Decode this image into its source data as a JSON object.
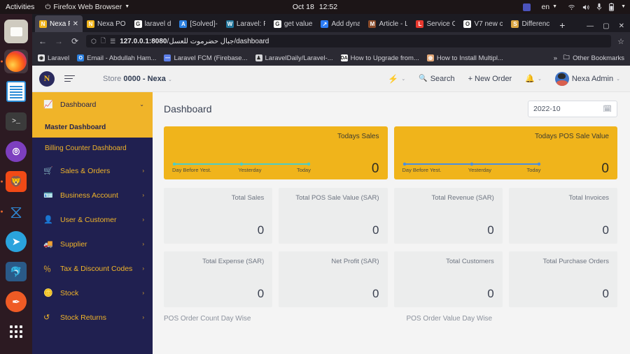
{
  "os_bar": {
    "activities": "Activities",
    "app_name": "Firefox Web Browser",
    "date": "Oct 18",
    "time": "12:52",
    "keyboard": "en",
    "tray_icons": [
      "teams-icon",
      "wifi-icon",
      "volume-icon",
      "microphone-icon",
      "battery-icon"
    ]
  },
  "dock": {
    "items": [
      {
        "name": "files-app",
        "label": "Files"
      },
      {
        "name": "firefox-app",
        "label": "Firefox Web Browser"
      },
      {
        "name": "libreoffice-writer-app",
        "label": "LibreOffice Writer"
      },
      {
        "name": "terminal-app",
        "label": "Terminal"
      },
      {
        "name": "github-desktop-app",
        "label": "GitHub Desktop"
      },
      {
        "name": "brave-browser-app",
        "label": "Brave Browser"
      },
      {
        "name": "vscode-app",
        "label": "Visual Studio Code"
      },
      {
        "name": "telegram-app",
        "label": "Telegram"
      },
      {
        "name": "mysql-workbench-app",
        "label": "MySQL Workbench"
      },
      {
        "name": "postman-app",
        "label": "Postman"
      },
      {
        "name": "show-applications",
        "label": "Show Applications"
      }
    ]
  },
  "browser": {
    "tabs": [
      {
        "title": "Nexa P",
        "favicon_letter": "N",
        "favicon_color": "#f0b41b",
        "selected": true
      },
      {
        "title": "Nexa PO",
        "favicon_letter": "N",
        "favicon_color": "#f0b41b",
        "selected": false
      },
      {
        "title": "laravel d",
        "favicon_letter": "G",
        "favicon_color": "#ffffff",
        "selected": false
      },
      {
        "title": "[Solved]-",
        "favicon_letter": "A",
        "favicon_color": "#2a7fe0",
        "selected": false
      },
      {
        "title": "Laravel: F",
        "favicon_letter": "W",
        "favicon_color": "#21759b",
        "selected": false
      },
      {
        "title": "get value",
        "favicon_letter": "G",
        "favicon_color": "#ffffff",
        "selected": false
      },
      {
        "title": "Add dyna",
        "favicon_letter": "↗",
        "favicon_color": "#2d7df6",
        "selected": false
      },
      {
        "title": "Article - L",
        "favicon_letter": "M",
        "favicon_color": "#8a4b2a",
        "selected": false
      },
      {
        "title": "Service C",
        "favicon_letter": "L",
        "favicon_color": "#e8392f",
        "selected": false
      },
      {
        "title": "V7 new c",
        "favicon_letter": "O",
        "favicon_color": "#ffffff",
        "selected": false
      },
      {
        "title": "Differenc",
        "favicon_letter": "S",
        "favicon_color": "#d9a441",
        "selected": false
      }
    ],
    "new_tab_label": "+",
    "window_controls": [
      "minimize",
      "maximize",
      "close"
    ],
    "nav": {
      "back": "←",
      "forward": "→",
      "reload": "⟳",
      "url_prefix": "127.0.0.1:8080",
      "url_suffix": "/جبال حضرموت للعسل/dashboard",
      "shield_icon": "shield-icon",
      "page_icon": "page-icon",
      "reader_icon": "reader-icon",
      "bookmark_star": "☆"
    },
    "bookmarks": [
      {
        "label": "Laravel",
        "letter": "◉",
        "color": "#e8e8ea"
      },
      {
        "label": "Email - Abdullah Ham...",
        "letter": "O",
        "color": "#2a7fe0"
      },
      {
        "label": "Laravel FCM (Firebase...",
        "letter": "—",
        "color": "#5c7ee8"
      },
      {
        "label": "LaravelDaily/Laravel-...",
        "letter": "♟",
        "color": "#d7d7da"
      },
      {
        "label": "How to Upgrade from...",
        "letter": "DA",
        "color": "#ffffff"
      },
      {
        "label": "How to Install Multipl...",
        "letter": "◍",
        "color": "#e2a878"
      }
    ],
    "bookmarks_overflow": "»",
    "other_bookmarks": "Other Bookmarks"
  },
  "app": {
    "header": {
      "logo_letter": "N",
      "store_prefix": "Store",
      "store_name": "0000 - Nexa",
      "quick_action_icon": "bolt-icon",
      "search_label": "Search",
      "new_order_label": "+ New Order",
      "notification_icon": "bell-icon",
      "user_name": "Nexa Admin"
    },
    "sidebar": {
      "items": [
        {
          "label": "Dashboard",
          "icon": "chart-line-icon",
          "chevron": "⌄",
          "active": true
        },
        {
          "label": "Master Dashboard",
          "type": "sub",
          "active": true
        },
        {
          "label": "Billing Counter Dashboard",
          "type": "sub",
          "active": false
        },
        {
          "label": "Sales & Orders",
          "icon": "cart-icon",
          "chevron": "›",
          "active": false
        },
        {
          "label": "Business Account",
          "icon": "card-icon",
          "chevron": "›",
          "active": false
        },
        {
          "label": "User & Customer",
          "icon": "user-icon",
          "chevron": "›",
          "active": false
        },
        {
          "label": "Supplier",
          "icon": "truck-icon",
          "chevron": "›",
          "active": false
        },
        {
          "label": "Tax & Discount Codes",
          "icon": "percent-icon",
          "chevron": "›",
          "active": false
        },
        {
          "label": "Stock",
          "icon": "coins-icon",
          "chevron": "›",
          "active": false
        },
        {
          "label": "Stock Returns",
          "icon": "undo-icon",
          "chevron": "›",
          "active": false
        }
      ]
    },
    "main": {
      "page_title": "Dashboard",
      "date_value": "2022-10",
      "calendar_icon": "calendar-icon",
      "highlight_cards": [
        {
          "title": "Todays Sales",
          "value": "0",
          "line_color": "#4ecdc4",
          "labels": [
            "Day Before Yest.",
            "Yesterday",
            "Today"
          ]
        },
        {
          "title": "Todays POS Sale Value",
          "value": "0",
          "line_color": "#4a8fe0",
          "labels": [
            "Day Before Yest.",
            "Yesterday",
            "Today"
          ]
        }
      ],
      "stat_cards_row1": [
        {
          "title": "Total Sales",
          "value": "0"
        },
        {
          "title": "Total POS Sale Value (SAR)",
          "value": "0"
        },
        {
          "title": "Total Revenue (SAR)",
          "value": "0"
        },
        {
          "title": "Total Invoices",
          "value": "0"
        }
      ],
      "stat_cards_row2": [
        {
          "title": "Total Expense (SAR)",
          "value": "0"
        },
        {
          "title": "Net Profit (SAR)",
          "value": "0"
        },
        {
          "title": "Total Customers",
          "value": "0"
        },
        {
          "title": "Total Purchase Orders",
          "value": "0"
        }
      ],
      "chart_labels": [
        "POS Order Count Day Wise",
        "POS Order Value Day Wise"
      ]
    }
  },
  "chart_data": [
    {
      "type": "line",
      "title": "Todays Sales",
      "categories": [
        "Day Before Yest.",
        "Yesterday",
        "Today"
      ],
      "values": [
        0,
        0,
        0
      ],
      "xlabel": "",
      "ylabel": "",
      "ylim": [
        0,
        0
      ],
      "series_color": "#4ecdc4",
      "grid": false,
      "legend": "none"
    },
    {
      "type": "line",
      "title": "Todays POS Sale Value",
      "categories": [
        "Day Before Yest.",
        "Yesterday",
        "Today"
      ],
      "values": [
        0,
        0,
        0
      ],
      "xlabel": "",
      "ylabel": "",
      "ylim": [
        0,
        0
      ],
      "series_color": "#4a8fe0",
      "grid": false,
      "legend": "none"
    },
    {
      "type": "bar",
      "title": "POS Order Count Day Wise",
      "categories": [],
      "values": [],
      "xlabel": "",
      "ylabel": "",
      "grid": false,
      "legend": "none"
    },
    {
      "type": "bar",
      "title": "POS Order Value Day Wise",
      "categories": [],
      "values": [],
      "xlabel": "",
      "ylabel": "",
      "grid": false,
      "legend": "none"
    }
  ]
}
